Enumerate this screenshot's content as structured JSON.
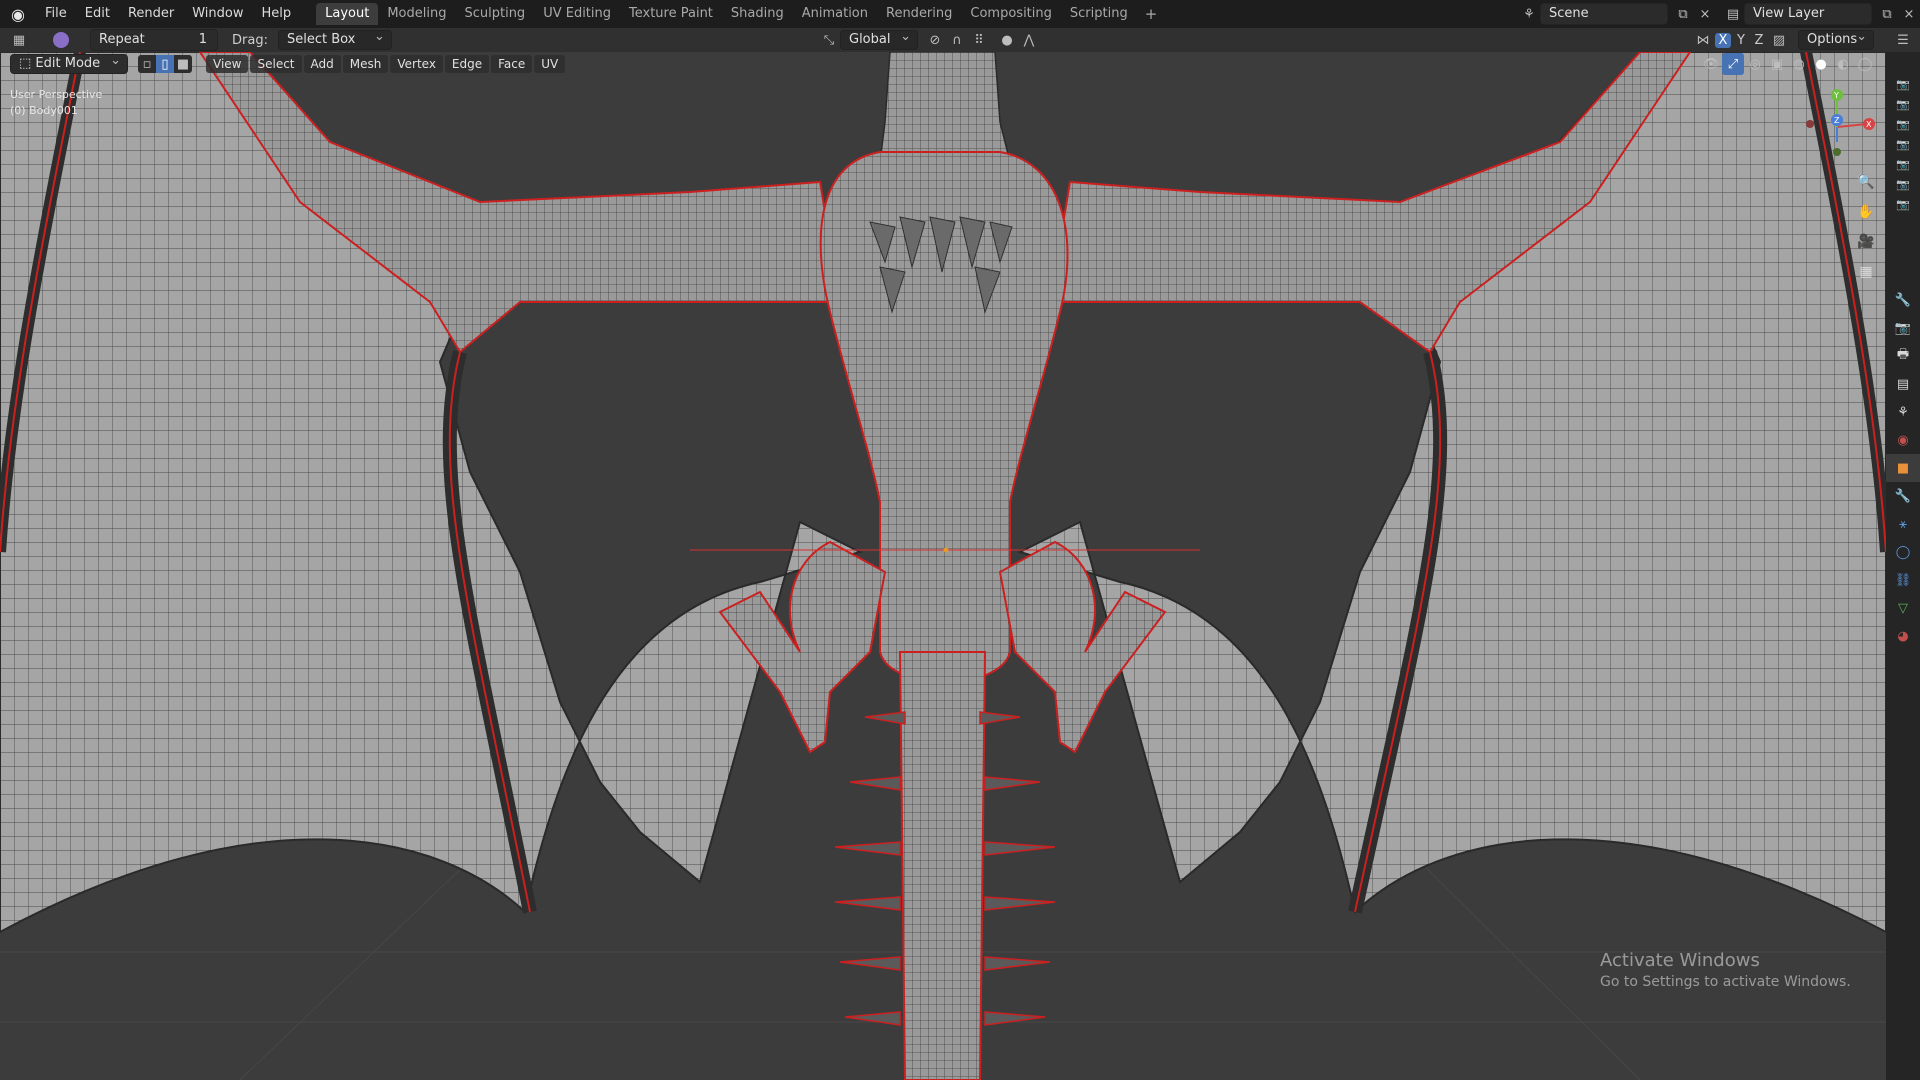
{
  "menubar": {
    "items": [
      "File",
      "Edit",
      "Render",
      "Window",
      "Help"
    ]
  },
  "workspaces": {
    "tabs": [
      "Layout",
      "Modeling",
      "Sculpting",
      "UV Editing",
      "Texture Paint",
      "Shading",
      "Animation",
      "Rendering",
      "Compositing",
      "Scripting"
    ],
    "active": "Layout"
  },
  "scene": {
    "name": "Scene"
  },
  "view_layer": {
    "name": "View Layer"
  },
  "tool_header": {
    "last_operator": "Repeat",
    "repeat_count": "1",
    "drag_label": "Drag:",
    "drag_value": "Select Box",
    "transform_orientation": "Global",
    "axes": [
      "X",
      "Y",
      "Z"
    ],
    "options_label": "Options"
  },
  "viewport_header": {
    "mode": "Edit Mode",
    "menus": [
      "View",
      "Select",
      "Add",
      "Mesh",
      "Vertex",
      "Edge",
      "Face",
      "UV"
    ]
  },
  "viewport_info": {
    "view_name": "User Perspective",
    "object_name": "(0) Body001"
  },
  "gizmo": {
    "x": "X",
    "y": "Y",
    "z": "Z"
  },
  "watermark": {
    "title": "Activate Windows",
    "subtitle": "Go to Settings to activate Windows."
  },
  "colors": {
    "accent_selected": "#e12a2a",
    "mesh_surface": "#9c9c9c",
    "viewport_bg": "#3c3c3c",
    "topbar_bg": "#1d1d1d"
  },
  "icons": {
    "properties": [
      "tool-icon",
      "render-icon",
      "output-icon",
      "view-layer-icon",
      "scene-icon",
      "world-icon",
      "object-icon",
      "modifier-icon",
      "particles-icon",
      "physics-icon",
      "constraints-icon",
      "data-icon",
      "material-icon"
    ]
  }
}
